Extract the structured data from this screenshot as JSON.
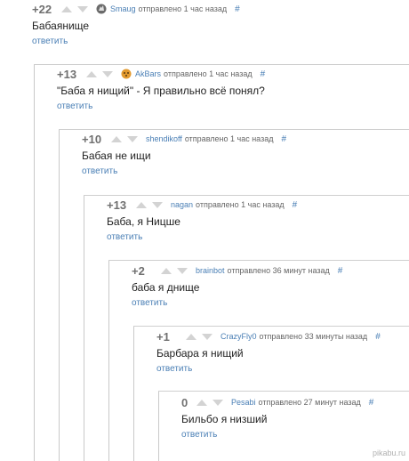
{
  "comments": [
    {
      "score": "+22",
      "author": "Smaug",
      "avatar": "dragon-avatar",
      "sent": "отправлено 1 час назад",
      "hash": "#",
      "text": "Бабаянище",
      "reply": "ответить"
    },
    {
      "score": "+13",
      "author": "AkBars",
      "avatar": "leopard-avatar",
      "sent": "отправлено 1 час назад",
      "hash": "#",
      "text": "\"Баба я нищий\" - Я правильно всё понял?",
      "reply": "ответить"
    },
    {
      "score": "+10",
      "author": "shendikoff",
      "avatar": "",
      "sent": "отправлено 1 час назад",
      "hash": "#",
      "text": "Бабая не ищи",
      "reply": "ответить"
    },
    {
      "score": "+13",
      "author": "nagan",
      "avatar": "",
      "sent": "отправлено 1 час назад",
      "hash": "#",
      "text": "Баба, я Ницше",
      "reply": "ответить"
    },
    {
      "score": "+2",
      "author": "brainbot",
      "avatar": "",
      "sent": "отправлено 36 минут назад",
      "hash": "#",
      "text": "баба я днище",
      "reply": "ответить"
    },
    {
      "score": "+1",
      "author": "CrazyFly0",
      "avatar": "",
      "sent": "отправлено 33 минуты назад",
      "hash": "#",
      "text": "Барбара я нищий",
      "reply": "ответить"
    },
    {
      "score": "0",
      "author": "Pesabi",
      "avatar": "",
      "sent": "отправлено 27 минут назад",
      "hash": "#",
      "text": "Бильбо я низший",
      "reply": "ответить"
    }
  ],
  "watermark": "pikabu.ru",
  "colors": {
    "link": "#4a7fb5",
    "score": "#707070",
    "thread_line": "#c9c9c9",
    "arrow": "#d3d3d3"
  }
}
